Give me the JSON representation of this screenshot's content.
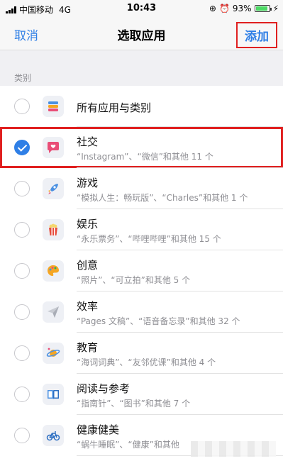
{
  "status_bar": {
    "carrier": "中国移动",
    "network": "4G",
    "time": "10:43",
    "battery": "93%"
  },
  "nav": {
    "cancel": "取消",
    "title": "选取应用",
    "add": "添加"
  },
  "section": {
    "title": "类别"
  },
  "rows": [
    {
      "title": "所有应用与类别",
      "subtitle": "",
      "icon": "stack-icon"
    },
    {
      "title": "社交",
      "subtitle": "“Instagram”、“微信”和其他 11 个",
      "icon": "chat-bubble-icon"
    },
    {
      "title": "游戏",
      "subtitle": "“模拟人生：畅玩版”、“Charles”和其他 1 个",
      "icon": "rocket-icon"
    },
    {
      "title": "娱乐",
      "subtitle": "“永乐票务”、“哔哩哔哩”和其他 15 个",
      "icon": "popcorn-icon"
    },
    {
      "title": "创意",
      "subtitle": "“照片”、“可立拍”和其他 5 个",
      "icon": "palette-icon"
    },
    {
      "title": "效率",
      "subtitle": "“Pages 文稿”、“语音备忘录”和其他 32 个",
      "icon": "paper-plane-icon"
    },
    {
      "title": "教育",
      "subtitle": "“海词词典”、“友邻优课”和其他 4 个",
      "icon": "planet-icon"
    },
    {
      "title": "阅读与参考",
      "subtitle": "“指南针”、“图书”和其他 7 个",
      "icon": "book-icon"
    },
    {
      "title": "健康健美",
      "subtitle": "“蜗牛睡眠”、“健康”和其他",
      "icon": "bicycle-icon"
    }
  ],
  "colors": {
    "accent": "#2f7fe6",
    "highlight_box": "#e02020"
  }
}
